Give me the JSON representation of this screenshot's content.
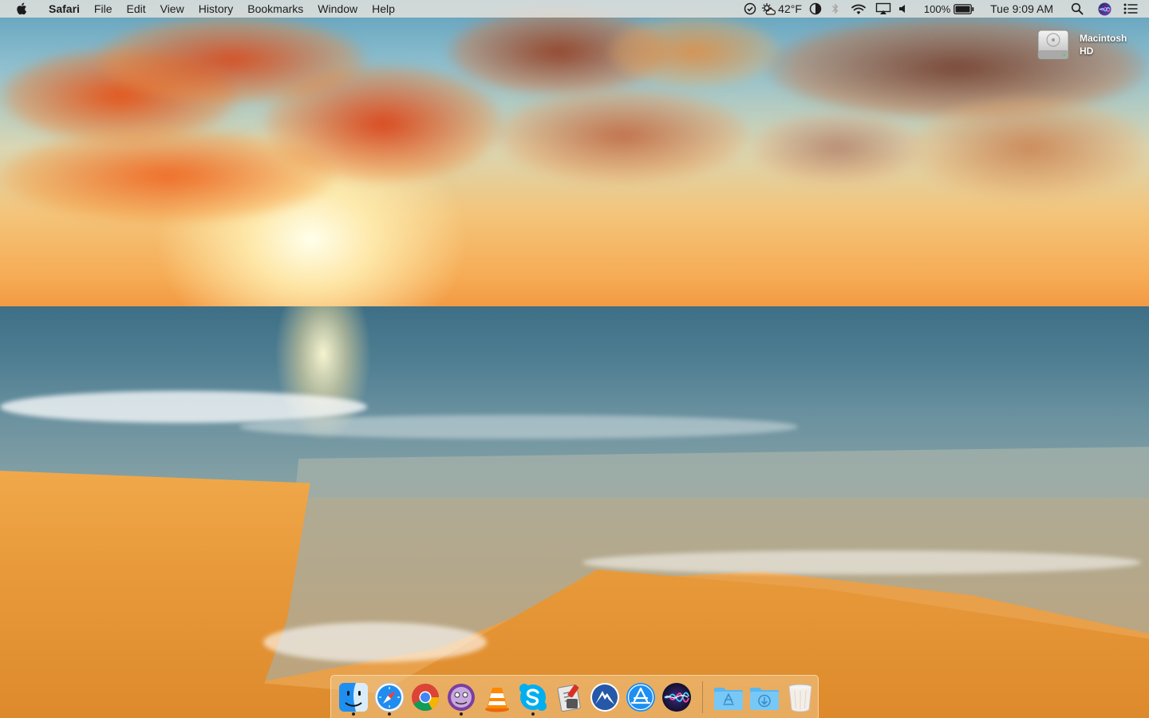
{
  "menubar": {
    "app_name": "Safari",
    "items": [
      "File",
      "Edit",
      "View",
      "History",
      "Bookmarks",
      "Window",
      "Help"
    ],
    "status": {
      "weather": "42°F",
      "battery": "100%",
      "clock": "Tue 9:09 AM"
    }
  },
  "desktop": {
    "disk_label": "Macintosh HD"
  },
  "dock": {
    "apps": [
      {
        "icon": "finder-icon",
        "running": true
      },
      {
        "icon": "safari-icon",
        "running": true
      },
      {
        "icon": "chrome-icon",
        "running": false
      },
      {
        "icon": "alfred-icon",
        "running": true
      },
      {
        "icon": "vlc-icon",
        "running": false
      },
      {
        "icon": "skype-icon",
        "running": true
      },
      {
        "icon": "script-editor-icon",
        "running": false
      },
      {
        "icon": "nordvpn-icon",
        "running": false
      },
      {
        "icon": "app-store-icon",
        "running": false
      },
      {
        "icon": "siri-icon",
        "running": false
      }
    ],
    "stacks": [
      {
        "icon": "applications-folder-icon"
      },
      {
        "icon": "downloads-folder-icon"
      },
      {
        "icon": "trash-icon"
      }
    ]
  },
  "colors": {
    "menubar_bg": "#e8e4de",
    "sky_top": "#5f9fbc",
    "sunset": "#f39a44",
    "sea": "#3e6f86",
    "sand": "#e89a3a"
  }
}
